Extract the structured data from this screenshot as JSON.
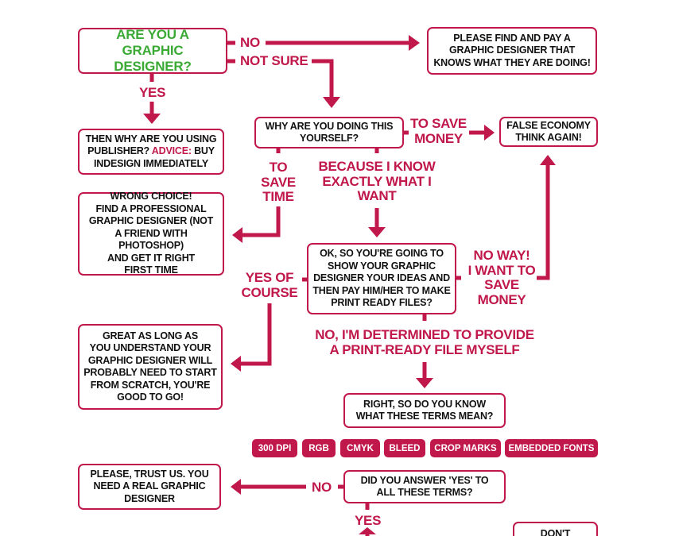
{
  "colors": {
    "accent": "#c0184a",
    "start_text": "#3aaa35",
    "text": "#111111"
  },
  "nodes": {
    "start": [
      "ARE YOU A",
      "GRAPHIC DESIGNER?"
    ],
    "hire": [
      "PLEASE FIND AND PAY A",
      "GRAPHIC DESIGNER THAT",
      "KNOWS WHAT THEY ARE DOING!"
    ],
    "why": [
      "WHY ARE YOU DOING THIS",
      "YOURSELF?"
    ],
    "false_economy": [
      "FALSE ECONOMY",
      "THINK AGAIN!"
    ],
    "publisher": {
      "line1": "THEN WHY ARE YOU USING",
      "line2_a": "PUBLISHER? ",
      "line2_advice": "ADVICE:",
      "line2_b": " BUY",
      "line3": "INDESIGN IMMEDIATELY"
    },
    "wrong_choice": [
      "WRONG CHOICE!",
      "FIND A PROFESSIONAL",
      "GRAPHIC DESIGNER (NOT",
      "A FRIEND WITH PHOTOSHOP)",
      "AND GET IT RIGHT",
      "FIRST TIME"
    ],
    "show_ideas": [
      "OK, SO YOU'RE GOING TO",
      "SHOW YOUR GRAPHIC",
      "DESIGNER YOUR IDEAS AND",
      "THEN PAY HIM/HER TO MAKE",
      "PRINT READY FILES?"
    ],
    "great": [
      "GREAT AS LONG AS",
      "YOU UNDERSTAND YOUR",
      "GRAPHIC DESIGNER WILL",
      "PROBABLY NEED TO START",
      "FROM SCRATCH, YOU'RE",
      "GOOD TO GO!"
    ],
    "know_terms": [
      "RIGHT, SO DO YOU KNOW",
      "WHAT THESE TERMS MEAN?"
    ],
    "answer_yes": [
      "DID YOU ANSWER 'YES' TO",
      "ALL THESE TERMS?"
    ],
    "trust_us": [
      "PLEASE, TRUST US. YOU",
      "NEED A REAL GRAPHIC",
      "DESIGNER"
    ],
    "dont": [
      "DON'T"
    ]
  },
  "terms": [
    "300 DPI",
    "RGB",
    "CMYK",
    "BLEED",
    "CROP MARKS",
    "EMBEDDED FONTS"
  ],
  "labels": {
    "no": "NO",
    "not_sure": "NOT SURE",
    "yes": "YES",
    "to_save_money": [
      "TO SAVE",
      "MONEY"
    ],
    "to_save_time": [
      "TO",
      "SAVE",
      "TIME"
    ],
    "because": [
      "BECAUSE I KNOW",
      "EXACTLY WHAT I",
      "WANT"
    ],
    "yes_of_course": [
      "YES OF",
      "COURSE"
    ],
    "no_way": [
      "NO WAY!",
      "I WANT TO",
      "SAVE",
      "MONEY"
    ],
    "determined": [
      "NO, I'M DETERMINED TO PROVIDE",
      "A PRINT-READY FILE MYSELF"
    ],
    "no2": "NO",
    "yes2": "YES"
  }
}
